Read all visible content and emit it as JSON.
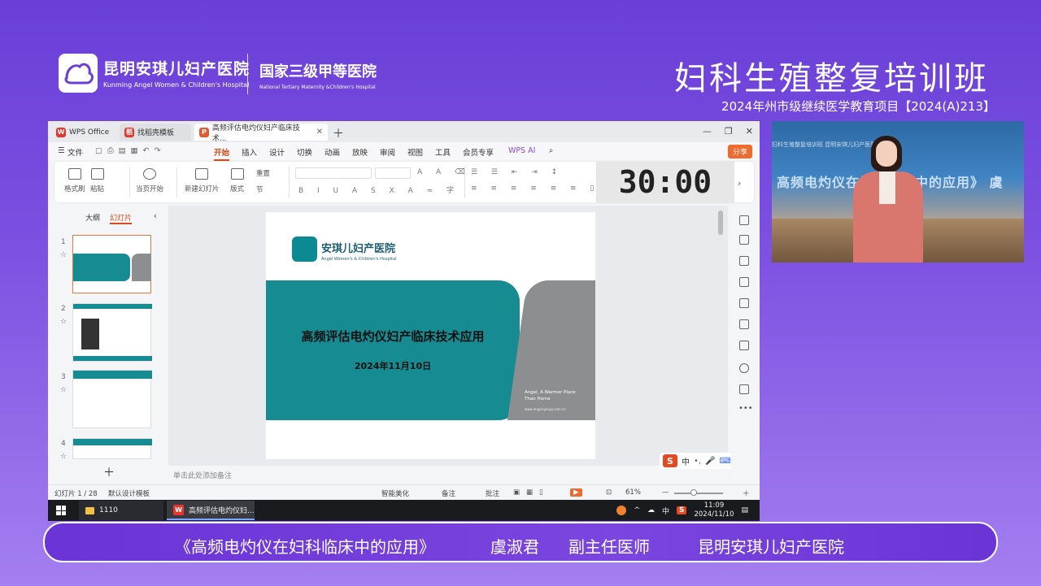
{
  "header": {
    "hospital_name_cn": "昆明安琪儿妇产医院",
    "hospital_name_en": "Kunming Angel Women & Children's Hospital",
    "grade_cn": "国家三级甲等医院",
    "grade_en": "National Tertiary Maternity &Children's Hospital",
    "course_title": "妇科生殖整复培训班",
    "course_subtitle": "2024年州市级继续医学教育项目【2024(A)213】"
  },
  "tabs": [
    {
      "label": "WPS Office",
      "icon": "W",
      "color": "#e8362e"
    },
    {
      "label": "找稻壳模板",
      "icon": "稻",
      "color": "#e8362e"
    },
    {
      "label": "高频评估电灼仪妇产临床技术...",
      "icon": "P",
      "color": "#e8582e"
    }
  ],
  "menu": {
    "file": "文件",
    "items": [
      "开始",
      "插入",
      "设计",
      "切换",
      "动画",
      "放映",
      "审阅",
      "视图",
      "工具",
      "会员专享"
    ],
    "active": "开始",
    "wps_ai": "WPS AI",
    "share": "分享"
  },
  "ribbon": {
    "format_painter": "格式刷",
    "paste": "粘贴",
    "play_from_start": "当页开始",
    "new_slide": "新建幻灯片",
    "layout": "版式",
    "reset": "重置",
    "section": "节"
  },
  "timer": "30:00",
  "left_pane": {
    "tab_outline": "大纲",
    "tab_slides": "幻灯片",
    "thumb_numbers": [
      "1",
      "2",
      "3",
      "4"
    ]
  },
  "slide": {
    "logo_cn": "安琪儿妇产医院",
    "logo_en": "Angel Women's & Children's Hospital",
    "title": "高频评估电灼仪妇产临床技术应用",
    "date": "2024年11月10日",
    "tagline_1": "Angel, A Warmer Place",
    "tagline_2": "Than Home",
    "url": "www.angel-group.com.cn"
  },
  "notes_placeholder": "单击此处添加备注",
  "statusbar": {
    "slide_count": "幻灯片 1 / 28",
    "theme": "默认设计模板",
    "smart_beautify": "智能美化",
    "notes": "备注",
    "comments": "批注",
    "zoom": "61%"
  },
  "taskbar": {
    "folder_label": "1110",
    "app_label": "高频评估电灼仪妇...",
    "ime": "中",
    "time": "11:09",
    "date": "2024/11/10"
  },
  "camera": {
    "screen_text": "高频电灼仪在妇科临床中的应用》  虞",
    "screen_top": "妇科生殖整复培训班 昆明安琪儿妇产医院"
  },
  "lower_third": {
    "topic": "《高频电灼仪在妇科临床中的应用》",
    "speaker": "虞淑君",
    "title": "副主任医师",
    "hospital": "昆明安琪儿妇产医院"
  }
}
